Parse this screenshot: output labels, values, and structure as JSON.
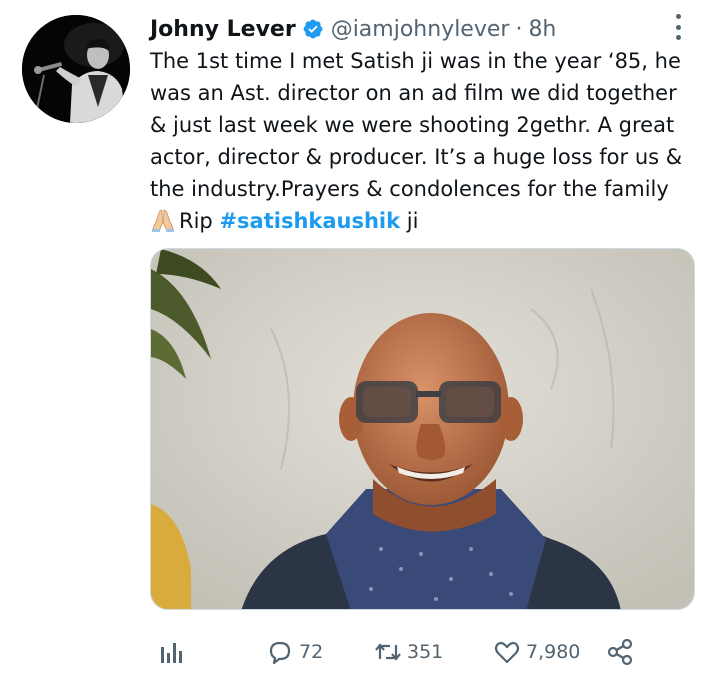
{
  "tweet": {
    "author_name": "Johny Lever",
    "verified_icon": "verified-badge-icon",
    "handle": "@iamjohnylever",
    "separator": "·",
    "time": "8h",
    "text_lines": [
      "The 1st time I met Satish ji was in the year ‘85, he",
      "was an Ast. director on an ad film we did together",
      "& just last week we were shooting 2gethr. A great",
      "actor, director & producer. It’s a huge loss for us &",
      "the industry.Prayers & condolences for the family"
    ],
    "last_line_prefix": "Rip ",
    "hashtag": "#satishkaushik",
    "last_line_suffix": " ji",
    "emoji_icon": "folded-hands-icon"
  },
  "actions": {
    "analytics_icon": "analytics-icon",
    "reply_count": "72",
    "retweet_count": "351",
    "like_count": "7,980",
    "share_icon": "share-icon"
  },
  "colors": {
    "accent": "#1d9bf0",
    "text_primary": "#0f1419",
    "text_secondary": "#536471"
  }
}
